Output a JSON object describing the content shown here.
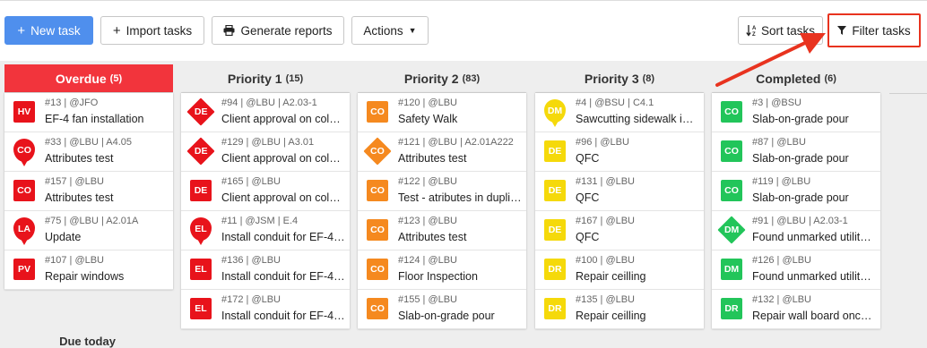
{
  "toolbar": {
    "new_task": "New task",
    "import_tasks": "Import tasks",
    "generate_reports": "Generate reports",
    "actions": "Actions",
    "sort_tasks": "Sort tasks",
    "filter_tasks": "Filter tasks"
  },
  "icons": {
    "plus": "plus-icon",
    "printer": "printer-icon",
    "caret": "caret-down-icon",
    "sort": "sort-alpha-icon",
    "filter": "funnel-icon"
  },
  "colors": {
    "primary": "#4f8fed",
    "overdue": "#f2343c",
    "red": "#e8131b",
    "orange": "#f5891f",
    "yellow": "#f5d90a",
    "green": "#22c55a",
    "annotation": "#e8331f"
  },
  "columns": [
    {
      "title": "Overdue",
      "count": "(5)",
      "cards": [
        {
          "badge": "HV",
          "shape": "square",
          "color": "#e8131b",
          "meta": "#13 | @JFO",
          "title": "EF-4 fan installation"
        },
        {
          "badge": "CO",
          "shape": "pin",
          "color": "#e8131b",
          "meta": "#33 | @LBU | A4.05",
          "title": "Attributes test"
        },
        {
          "badge": "CO",
          "shape": "square",
          "color": "#e8131b",
          "meta": "#157 | @LBU",
          "title": "Attributes test"
        },
        {
          "badge": "LA",
          "shape": "pin",
          "color": "#e8131b",
          "meta": "#75 | @LBU | A2.01A",
          "title": "Update"
        },
        {
          "badge": "PV",
          "shape": "square",
          "color": "#e8131b",
          "meta": "#107 | @LBU",
          "title": "Repair windows"
        }
      ],
      "footer": "Due today"
    },
    {
      "title": "Priority 1",
      "count": "(15)",
      "cards": [
        {
          "badge": "DE",
          "shape": "diamond",
          "color": "#e8131b",
          "meta": "#94 | @LBU | A2.03-1",
          "title": "Client approval on color…"
        },
        {
          "badge": "DE",
          "shape": "diamond",
          "color": "#e8131b",
          "meta": "#129 | @LBU | A3.01",
          "title": "Client approval on color…"
        },
        {
          "badge": "DE",
          "shape": "square",
          "color": "#e8131b",
          "meta": "#165 | @LBU",
          "title": "Client approval on color…"
        },
        {
          "badge": "EL",
          "shape": "pin",
          "color": "#e8131b",
          "meta": "#11 | @JSM | E.4",
          "title": "Install conduit for EF-4 f…"
        },
        {
          "badge": "EL",
          "shape": "square",
          "color": "#e8131b",
          "meta": "#136 | @LBU",
          "title": "Install conduit for EF-4 f…"
        },
        {
          "badge": "EL",
          "shape": "square",
          "color": "#e8131b",
          "meta": "#172 | @LBU",
          "title": "Install conduit for EF-4 f…"
        }
      ]
    },
    {
      "title": "Priority 2",
      "count": "(83)",
      "cards": [
        {
          "badge": "CO",
          "shape": "square",
          "color": "#f5891f",
          "meta": "#120 | @LBU",
          "title": "Safety Walk"
        },
        {
          "badge": "CO",
          "shape": "diamond",
          "color": "#f5891f",
          "meta": "#121 | @LBU | A2.01A222",
          "title": "Attributes test"
        },
        {
          "badge": "CO",
          "shape": "square",
          "color": "#f5891f",
          "meta": "#122 | @LBU",
          "title": "Test - atributes in duplic…"
        },
        {
          "badge": "CO",
          "shape": "square",
          "color": "#f5891f",
          "meta": "#123 | @LBU",
          "title": "Attributes test"
        },
        {
          "badge": "CO",
          "shape": "square",
          "color": "#f5891f",
          "meta": "#124 | @LBU",
          "title": "Floor Inspection"
        },
        {
          "badge": "CO",
          "shape": "square",
          "color": "#f5891f",
          "meta": "#155 | @LBU",
          "title": "Slab-on-grade pour"
        }
      ]
    },
    {
      "title": "Priority 3",
      "count": "(8)",
      "cards": [
        {
          "badge": "DM",
          "shape": "pin",
          "color": "#f5d90a",
          "meta": "#4 | @BSU | C4.1",
          "title": "Sawcutting sidewalk in …"
        },
        {
          "badge": "DE",
          "shape": "square",
          "color": "#f5d90a",
          "meta": "#96 | @LBU",
          "title": "QFC"
        },
        {
          "badge": "DE",
          "shape": "square",
          "color": "#f5d90a",
          "meta": "#131 | @LBU",
          "title": "QFC"
        },
        {
          "badge": "DE",
          "shape": "square",
          "color": "#f5d90a",
          "meta": "#167 | @LBU",
          "title": "QFC"
        },
        {
          "badge": "DR",
          "shape": "square",
          "color": "#f5d90a",
          "meta": "#100 | @LBU",
          "title": "Repair ceilling"
        },
        {
          "badge": "DR",
          "shape": "square",
          "color": "#f5d90a",
          "meta": "#135 | @LBU",
          "title": "Repair ceilling"
        }
      ]
    },
    {
      "title": "Completed",
      "count": "(6)",
      "cards": [
        {
          "badge": "CO",
          "shape": "square",
          "color": "#22c55a",
          "meta": "#3 | @BSU",
          "title": "Slab-on-grade pour"
        },
        {
          "badge": "CO",
          "shape": "square",
          "color": "#22c55a",
          "meta": "#87 | @LBU",
          "title": "Slab-on-grade pour"
        },
        {
          "badge": "CO",
          "shape": "square",
          "color": "#22c55a",
          "meta": "#119 | @LBU",
          "title": "Slab-on-grade pour"
        },
        {
          "badge": "DM",
          "shape": "diamond",
          "color": "#22c55a",
          "meta": "#91 | @LBU | A2.03-1",
          "title": "Found unmarked utility …"
        },
        {
          "badge": "DM",
          "shape": "square",
          "color": "#22c55a",
          "meta": "#126 | @LBU",
          "title": "Found unmarked utility …"
        },
        {
          "badge": "DR",
          "shape": "square",
          "color": "#22c55a",
          "meta": "#132 | @LBU",
          "title": "Repair wall board once t…"
        }
      ]
    }
  ]
}
